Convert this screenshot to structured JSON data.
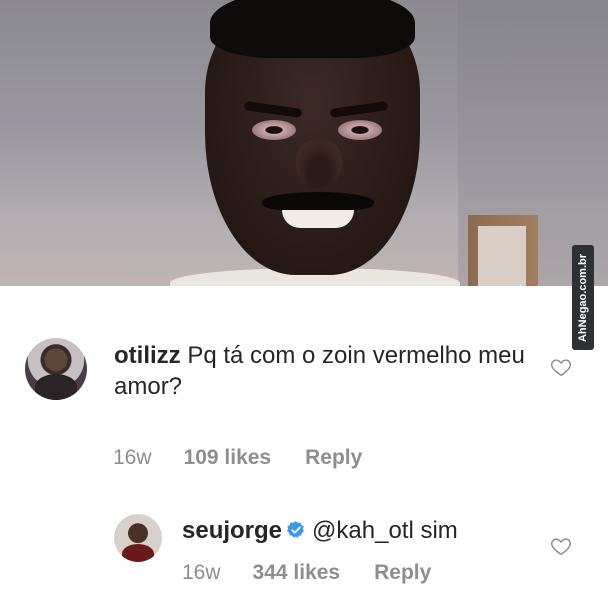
{
  "watermark": "AhNegao.com.br",
  "comments": [
    {
      "username": "otilizz",
      "text": "Pq tá com o zoin vermelho meu amor?",
      "time": "16w",
      "likes": "109 likes",
      "reply_label": "Reply"
    },
    {
      "username": "seujorge",
      "verified": true,
      "mention": "@kah_otl",
      "text": "sim",
      "time": "16w",
      "likes": "344 likes",
      "reply_label": "Reply"
    }
  ],
  "icons": [
    "heart-icon",
    "verified-badge-icon"
  ],
  "colors": {
    "text": "#262626",
    "meta": "#8e8e8e",
    "verified": "#3897f0",
    "mention": "#003569"
  }
}
